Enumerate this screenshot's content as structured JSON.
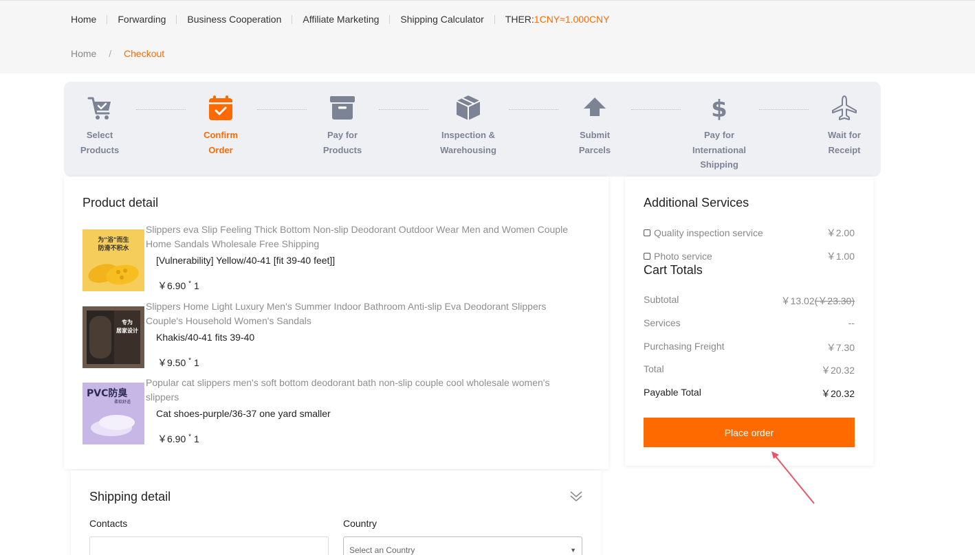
{
  "topnav": {
    "links": [
      "Home",
      "Forwarding",
      "Business Cooperation",
      "Affiliate Marketing",
      "Shipping Calculator"
    ],
    "rate_label": "THER:",
    "rate_value": "1CNY≈1.000CNY"
  },
  "breadcrumb": {
    "home": "Home",
    "separator": "/",
    "current": "Checkout"
  },
  "steps": [
    {
      "line1": "Select",
      "line2": "Products",
      "line3": "",
      "icon": "cart-icon",
      "active": false
    },
    {
      "line1": "Confirm",
      "line2": "Order",
      "line3": "",
      "icon": "calendar-check-icon",
      "active": true
    },
    {
      "line1": "Pay for",
      "line2": "Products",
      "line3": "",
      "icon": "archive-box-icon",
      "active": false
    },
    {
      "line1": "Inspection &",
      "line2": "Warehousing",
      "line3": "",
      "icon": "package-icon",
      "active": false
    },
    {
      "line1": "Submit",
      "line2": "Parcels",
      "line3": "",
      "icon": "upload-arrow-icon",
      "active": false
    },
    {
      "line1": "Pay for",
      "line2": "International",
      "line3": "Shipping",
      "icon": "dollar-icon",
      "active": false
    },
    {
      "line1": "Wait for",
      "line2": "Receipt",
      "line3": "",
      "icon": "airplane-icon",
      "active": false
    }
  ],
  "product_detail": {
    "title": "Product detail",
    "items": [
      {
        "title": "Slippers eva Slip Feeling Thick Bottom Non-slip Deodorant Outdoor Wear Men and Women Couple Home Sandals Wholesale Free Shipping",
        "spec": "[Vulnerability] Yellow/40-41 [fit 39-40 feet]]",
        "price": "￥6.90",
        "mult": "*",
        "qty": "1",
        "thumb_text_1": "为\"浴\"而生",
        "thumb_text_2": "防滑不积水"
      },
      {
        "title": "Slippers Home Light Luxury Men's Summer Indoor Bathroom Anti-slip Eva Deodorant Slippers Couple's Household Women's Sandals",
        "spec": "Khakis/40-41 fits 39-40",
        "price": "￥9.50",
        "mult": "*",
        "qty": "1",
        "thumb_text_1": "专为",
        "thumb_text_2": "居家设计"
      },
      {
        "title": "Popular cat slippers men's soft bottom deodorant bath non-slip couple cool wholesale women's slippers",
        "spec": "Cat shoes-purple/36-37 one yard smaller",
        "price": "￥6.90",
        "mult": "*",
        "qty": "1",
        "thumb_text_1": "PVC防臭",
        "thumb_text_2": "柔软舒适"
      }
    ]
  },
  "additional_services": {
    "title": "Additional Services",
    "items": [
      {
        "label": "Quality inspection service",
        "price": "￥2.00"
      },
      {
        "label": "Photo service",
        "price": "￥1.00"
      }
    ]
  },
  "cart_totals": {
    "title": "Cart Totals",
    "subtotal_label": "Subtotal",
    "subtotal_value": "￥13.02",
    "subtotal_original": "(￥23.30)",
    "services_label": "Services",
    "services_value": "--",
    "freight_label": "Purchasing Freight",
    "freight_value": "￥7.30",
    "total_label": "Total",
    "total_value": "￥20.32",
    "payable_label": "Payable Total",
    "payable_value": "￥20.32",
    "place_order": "Place order"
  },
  "shipping": {
    "title": "Shipping detail",
    "contacts_label": "Contacts",
    "country_label": "Country",
    "country_placeholder": "Select an Country"
  },
  "colors": {
    "accent": "#ff6a00",
    "step_gray": "#7b8395",
    "annotation_arrow": "#e8556a"
  }
}
